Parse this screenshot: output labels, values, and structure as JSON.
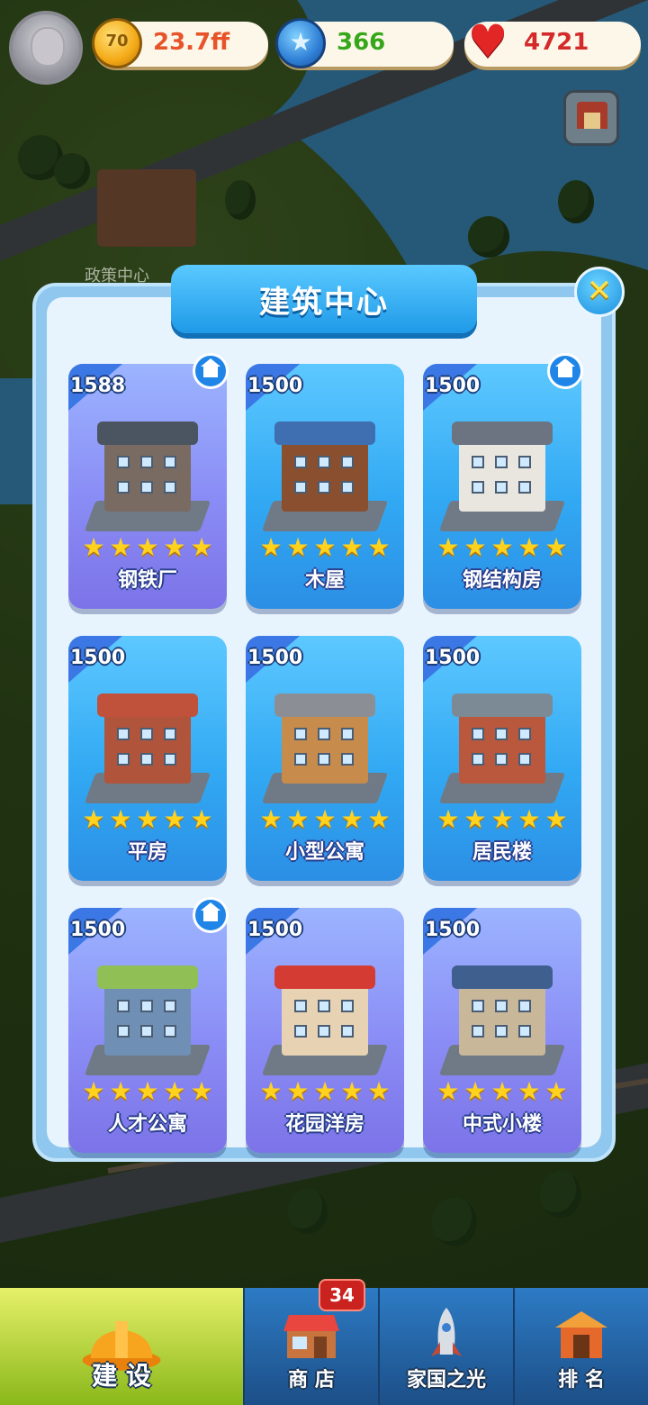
{
  "resources": {
    "coin_symbol": "70",
    "coins": "23.7ff",
    "stars": "366",
    "hearts": "4721"
  },
  "map_label": "政策中心",
  "dialog": {
    "title": "建筑中心",
    "close_symbol": "✕"
  },
  "cards": [
    {
      "price": "1588",
      "name": "钢铁厂",
      "stars": 5,
      "owned": true,
      "theme": "purple"
    },
    {
      "price": "1500",
      "name": "木屋",
      "stars": 5,
      "owned": false,
      "theme": "blue"
    },
    {
      "price": "1500",
      "name": "钢结构房",
      "stars": 5,
      "owned": true,
      "theme": "blue"
    },
    {
      "price": "1500",
      "name": "平房",
      "stars": 5,
      "owned": false,
      "theme": "blue"
    },
    {
      "price": "1500",
      "name": "小型公寓",
      "stars": 5,
      "owned": false,
      "theme": "blue"
    },
    {
      "price": "1500",
      "name": "居民楼",
      "stars": 5,
      "owned": false,
      "theme": "blue"
    },
    {
      "price": "1500",
      "name": "人才公寓",
      "stars": 5,
      "owned": true,
      "theme": "purple"
    },
    {
      "price": "1500",
      "name": "花园洋房",
      "stars": 5,
      "owned": false,
      "theme": "purple"
    },
    {
      "price": "1500",
      "name": "中式小楼",
      "stars": 5,
      "owned": false,
      "theme": "purple"
    }
  ],
  "nav": {
    "build": "建 设",
    "shop": "商 店",
    "shop_badge": "34",
    "homeland": "家国之光",
    "rank": "排 名"
  },
  "colors": {
    "card_blue": "#32a9f3",
    "card_purple": "#8a8cf5",
    "title_banner": "#1f9ae8",
    "coin_text": "#e8542a",
    "star_text": "#35a81a",
    "heart_text": "#d42a2a"
  }
}
